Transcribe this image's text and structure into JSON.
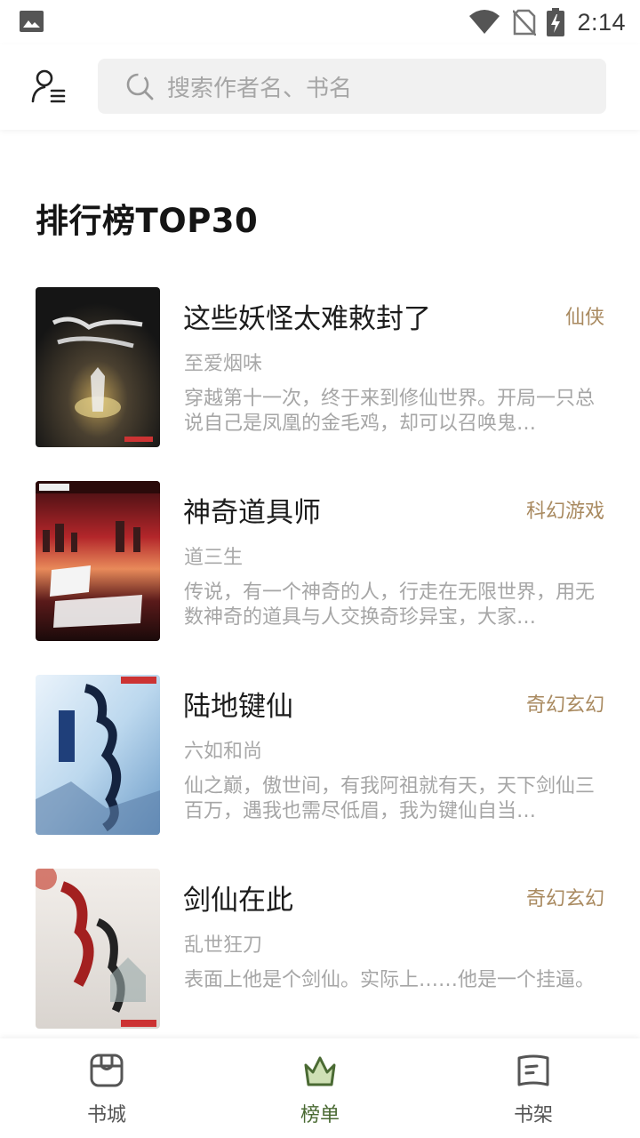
{
  "status_bar": {
    "time": "2:14",
    "icons": [
      "photo-icon",
      "wifi-icon",
      "no-sim-icon",
      "battery-charging-icon"
    ]
  },
  "header": {
    "left_icon": "user-menu-icon",
    "search": {
      "placeholder": "搜索作者名、书名",
      "icon": "search-icon"
    }
  },
  "main": {
    "title": "排行榜TOP30",
    "books": [
      {
        "title": "这些妖怪太难敕封了",
        "category": "仙侠",
        "author": "至爱烟味",
        "description": "穿越第十一次，终于来到修仙世界。开局一只总说自己是凤凰的金毛鸡，却可以召唤鬼…"
      },
      {
        "title": "神奇道具师",
        "category": "科幻游戏",
        "author": "道三生",
        "description": "传说，有一个神奇的人，行走在无限世界，用无数神奇的道具与人交换奇珍异宝，大家…"
      },
      {
        "title": "陆地键仙",
        "category": "奇幻玄幻",
        "author": "六如和尚",
        "description": "仙之巅，傲世间，有我阿祖就有天，天下剑仙三百万，遇我也需尽低眉，我为键仙自当…"
      },
      {
        "title": "剑仙在此",
        "category": "奇幻玄幻",
        "author": "乱世狂刀",
        "description": "表面上他是个剑仙。实际上……他是一个挂逼。"
      }
    ]
  },
  "bottom_nav": {
    "items": [
      {
        "label": "书城",
        "icon": "bookstore-icon",
        "active": false
      },
      {
        "label": "榜单",
        "icon": "crown-icon",
        "active": true
      },
      {
        "label": "书架",
        "icon": "bookshelf-icon",
        "active": false
      }
    ]
  },
  "colors": {
    "category": "#a98a60",
    "active_nav": "#4a6a33",
    "search_bg": "#f1f1f1"
  }
}
